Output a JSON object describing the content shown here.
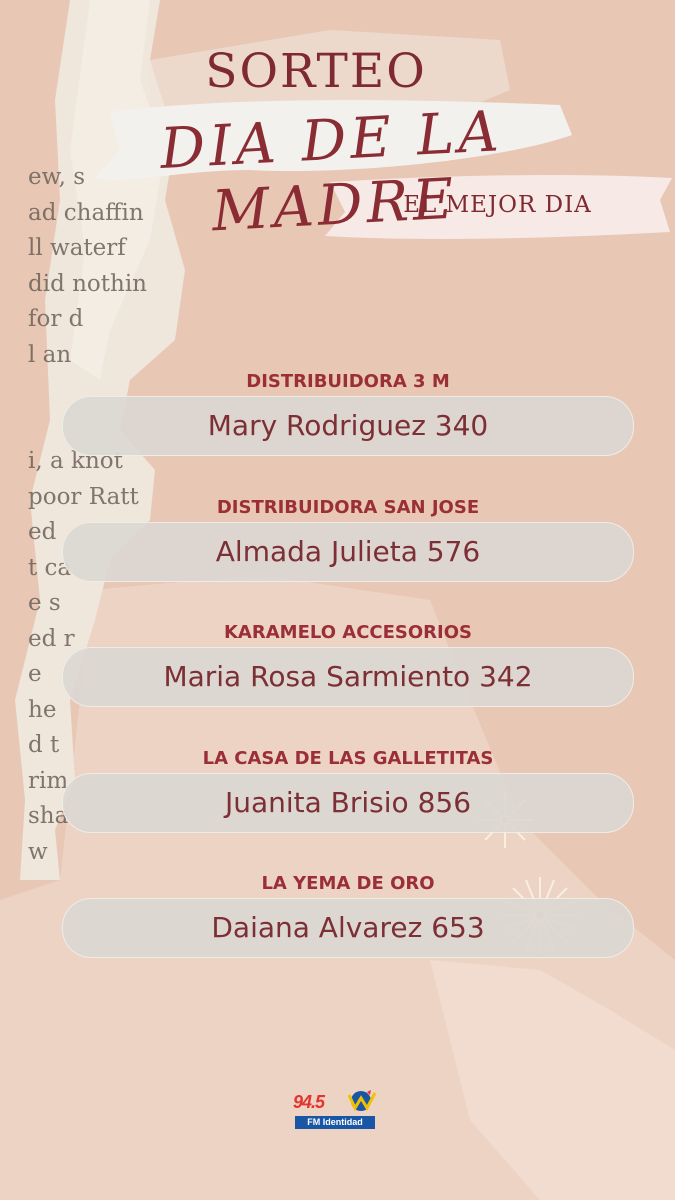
{
  "header": {
    "title": "SORTEO",
    "subtitle": "DIA DE LA MADRE",
    "tagline": "EL MEJOR DIA"
  },
  "winners": [
    {
      "store": "DISTRIBUIDORA 3 M",
      "name": "Mary Rodriguez 340"
    },
    {
      "store": "DISTRIBUIDORA SAN JOSE",
      "name": "Almada Julieta 576"
    },
    {
      "store": "KARAMELO ACCESORIOS",
      "name": "Maria Rosa Sarmiento 342"
    },
    {
      "store": "LA CASA DE LAS GALLETITAS",
      "name": "Juanita Brisio 856"
    },
    {
      "store": "LA YEMA DE ORO",
      "name": "Daiana Alvarez 653"
    }
  ],
  "decor": {
    "newsprint_lines": [
      "ew, s",
      "ad chaffin",
      "ll waterf",
      "did nothin",
      "for d",
      "l an",
      "",
      "",
      "i, a knot",
      "poor Ratt",
      "ed",
      "t ca",
      "e s",
      "ed r",
      "e",
      "he",
      "d t",
      "rim",
      "sha",
      "w"
    ]
  },
  "logo": {
    "number": "94.5",
    "label": "FM Identidad"
  },
  "colors": {
    "background": "#e8c7b5",
    "accent": "#8a2c34",
    "pill": "#dcd7d2",
    "logo_red": "#e3342f",
    "logo_blue": "#1a56a6"
  }
}
